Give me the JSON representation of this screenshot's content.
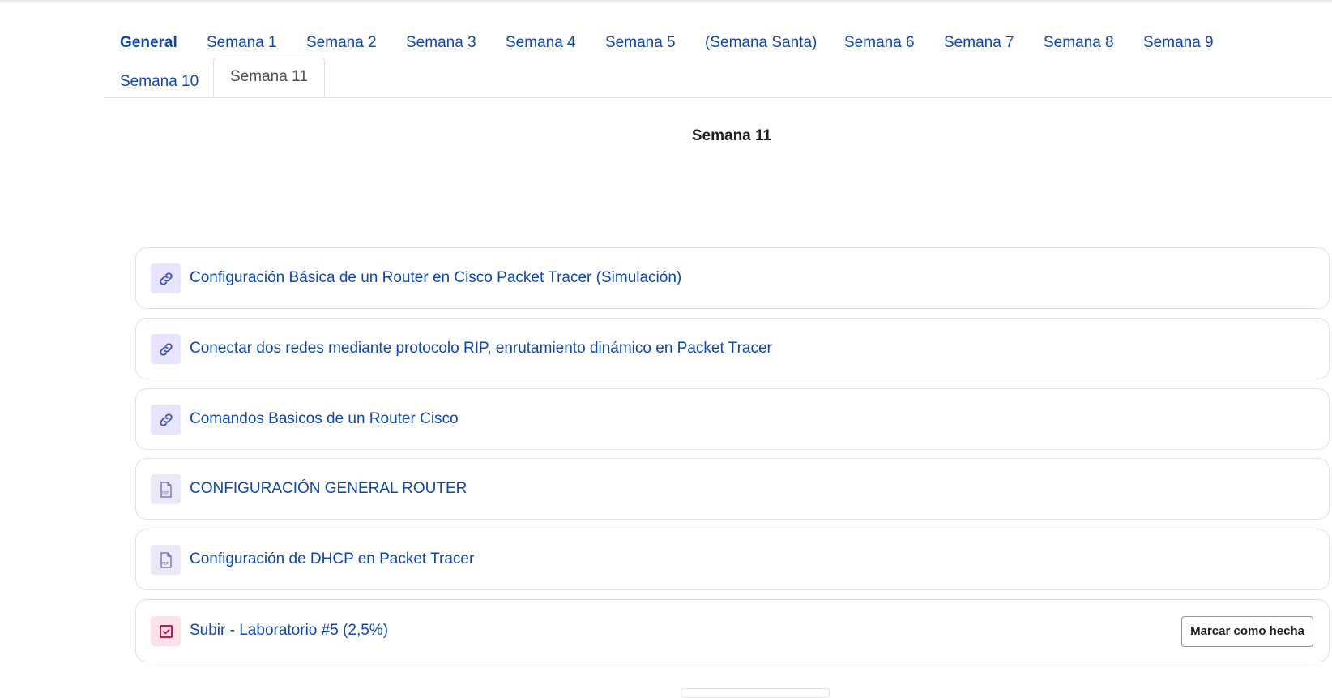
{
  "tabs": [
    {
      "label": "General"
    },
    {
      "label": "Semana 1"
    },
    {
      "label": "Semana 2"
    },
    {
      "label": "Semana 3"
    },
    {
      "label": "Semana 4"
    },
    {
      "label": "Semana 5"
    },
    {
      "label": "(Semana Santa)"
    },
    {
      "label": "Semana 6"
    },
    {
      "label": "Semana 7"
    },
    {
      "label": "Semana 8"
    },
    {
      "label": "Semana 9"
    },
    {
      "label": "Semana 10"
    },
    {
      "label": "Semana 11"
    }
  ],
  "active_tab": "Semana 11",
  "section": {
    "title": "Semana 11"
  },
  "activities": [
    {
      "name": "Configuración Básica de un Router en Cisco Packet Tracer (Simulación)",
      "icon": "link-icon"
    },
    {
      "name": "Conectar dos redes mediante protocolo RIP, enrutamiento dinámico en Packet Tracer",
      "icon": "link-icon"
    },
    {
      "name": "Comandos Basicos de un Router Cisco",
      "icon": "link-icon"
    },
    {
      "name": "CONFIGURACIÓN GENERAL ROUTER",
      "icon": "pdf-icon"
    },
    {
      "name": "Configuración de DHCP en Packet Tracer",
      "icon": "pdf-icon"
    },
    {
      "name": "Subir - Laboratorio #5 (2,5%)",
      "icon": "assignment-icon",
      "button": "Marcar como hecha"
    }
  ],
  "colors": {
    "link": "#0f47ad",
    "link_icon_bg": "#e7e4fb",
    "assign_icon_bg": "#fbe2e6",
    "assign_icon": "#c2185b",
    "border": "#dee2e6"
  }
}
